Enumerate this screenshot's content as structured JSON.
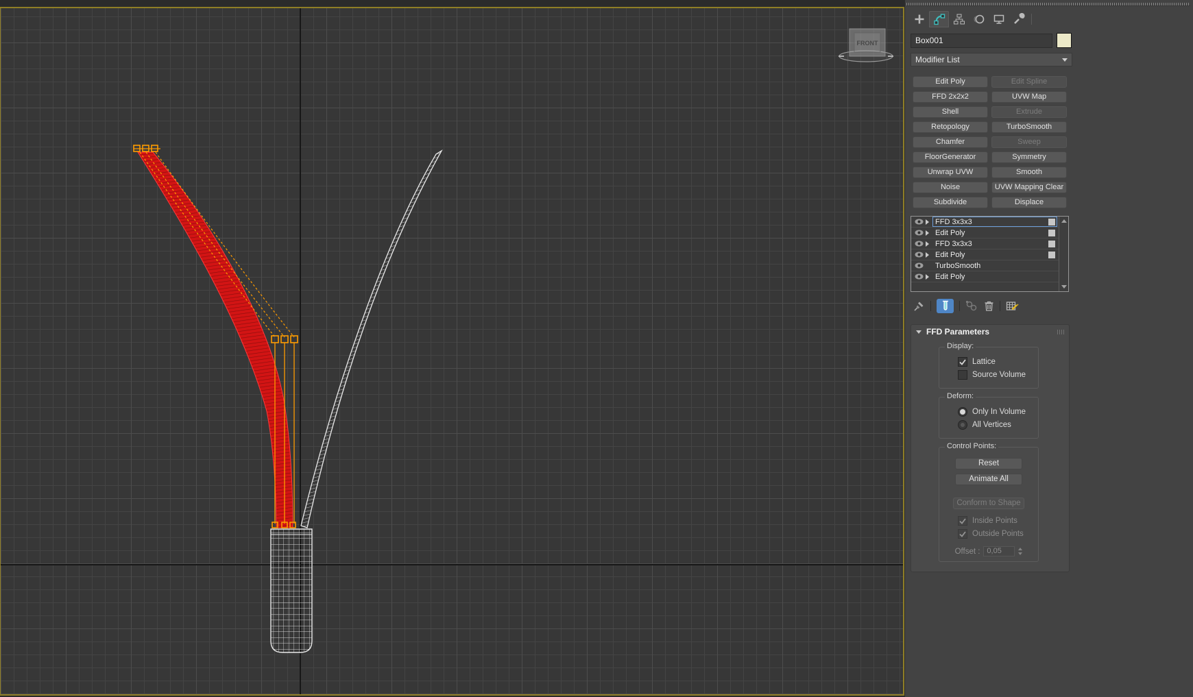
{
  "viewport": {
    "viewcube_label": "FRONT"
  },
  "panel": {
    "object_name": "Box001",
    "modifier_list_label": "Modifier List",
    "tabs": [
      {
        "name": "create"
      },
      {
        "name": "modify",
        "active": true
      },
      {
        "name": "hierarchy"
      },
      {
        "name": "motion"
      },
      {
        "name": "display"
      },
      {
        "name": "utilities"
      }
    ],
    "modifier_buttons": [
      {
        "label": "Edit Poly",
        "enabled": true
      },
      {
        "label": "Edit Spline",
        "enabled": false
      },
      {
        "label": "FFD 2x2x2",
        "enabled": true
      },
      {
        "label": "UVW Map",
        "enabled": true
      },
      {
        "label": "Shell",
        "enabled": true
      },
      {
        "label": "Extrude",
        "enabled": false
      },
      {
        "label": "Retopology",
        "enabled": true
      },
      {
        "label": "TurboSmooth",
        "enabled": true
      },
      {
        "label": "Chamfer",
        "enabled": true
      },
      {
        "label": "Sweep",
        "enabled": false
      },
      {
        "label": "FloorGenerator",
        "enabled": true
      },
      {
        "label": "Symmetry",
        "enabled": true
      },
      {
        "label": "Unwrap UVW",
        "enabled": true
      },
      {
        "label": "Smooth",
        "enabled": true
      },
      {
        "label": "Noise",
        "enabled": true
      },
      {
        "label": "UVW Mapping Clear",
        "enabled": true
      },
      {
        "label": "Subdivide",
        "enabled": true
      },
      {
        "label": "Displace",
        "enabled": true
      }
    ],
    "stack": {
      "items": [
        {
          "label": "FFD 3x3x3",
          "selected": true,
          "expandable": true,
          "toggle": true
        },
        {
          "label": "Edit Poly",
          "selected": false,
          "expandable": true,
          "toggle": true
        },
        {
          "label": "FFD 3x3x3",
          "selected": false,
          "expandable": true,
          "toggle": true
        },
        {
          "label": "Edit Poly",
          "selected": false,
          "expandable": true,
          "toggle": true
        },
        {
          "label": "TurboSmooth",
          "selected": false,
          "expandable": false,
          "toggle": false
        },
        {
          "label": "Edit Poly",
          "selected": false,
          "expandable": true,
          "toggle": false
        }
      ]
    },
    "rollout": {
      "title": "FFD Parameters",
      "display_group": {
        "label": "Display:",
        "lattice": {
          "label": "Lattice",
          "checked": true
        },
        "source_volume": {
          "label": "Source Volume",
          "checked": false
        }
      },
      "deform_group": {
        "label": "Deform:",
        "only_in_volume": {
          "label": "Only In Volume",
          "selected": true
        },
        "all_vertices": {
          "label": "All Vertices",
          "selected": false
        }
      },
      "control_points_group": {
        "label": "Control Points:",
        "reset_label": "Reset",
        "animate_all_label": "Animate All",
        "conform_label": "Conform to Shape",
        "inside_points": {
          "label": "Inside Points",
          "checked": true
        },
        "outside_points": {
          "label": "Outside Points",
          "checked": true
        },
        "offset_label": "Offset :",
        "offset_value": "0,05"
      }
    }
  },
  "colors": {
    "accent_teal": "#3fbdbd",
    "selection_blue": "#6d9ed9",
    "viewport_border": "#8f7e26",
    "object_color_swatch": "#ece9c8",
    "blade_red": "#d21414",
    "blade_red_dark": "#8e0d0d",
    "blade_red_bright": "#ff3b3b",
    "lattice_orange": "#ff9c00",
    "wire_white": "#e9e9e9",
    "show_end_result_active_bg": "#4f86c6"
  }
}
